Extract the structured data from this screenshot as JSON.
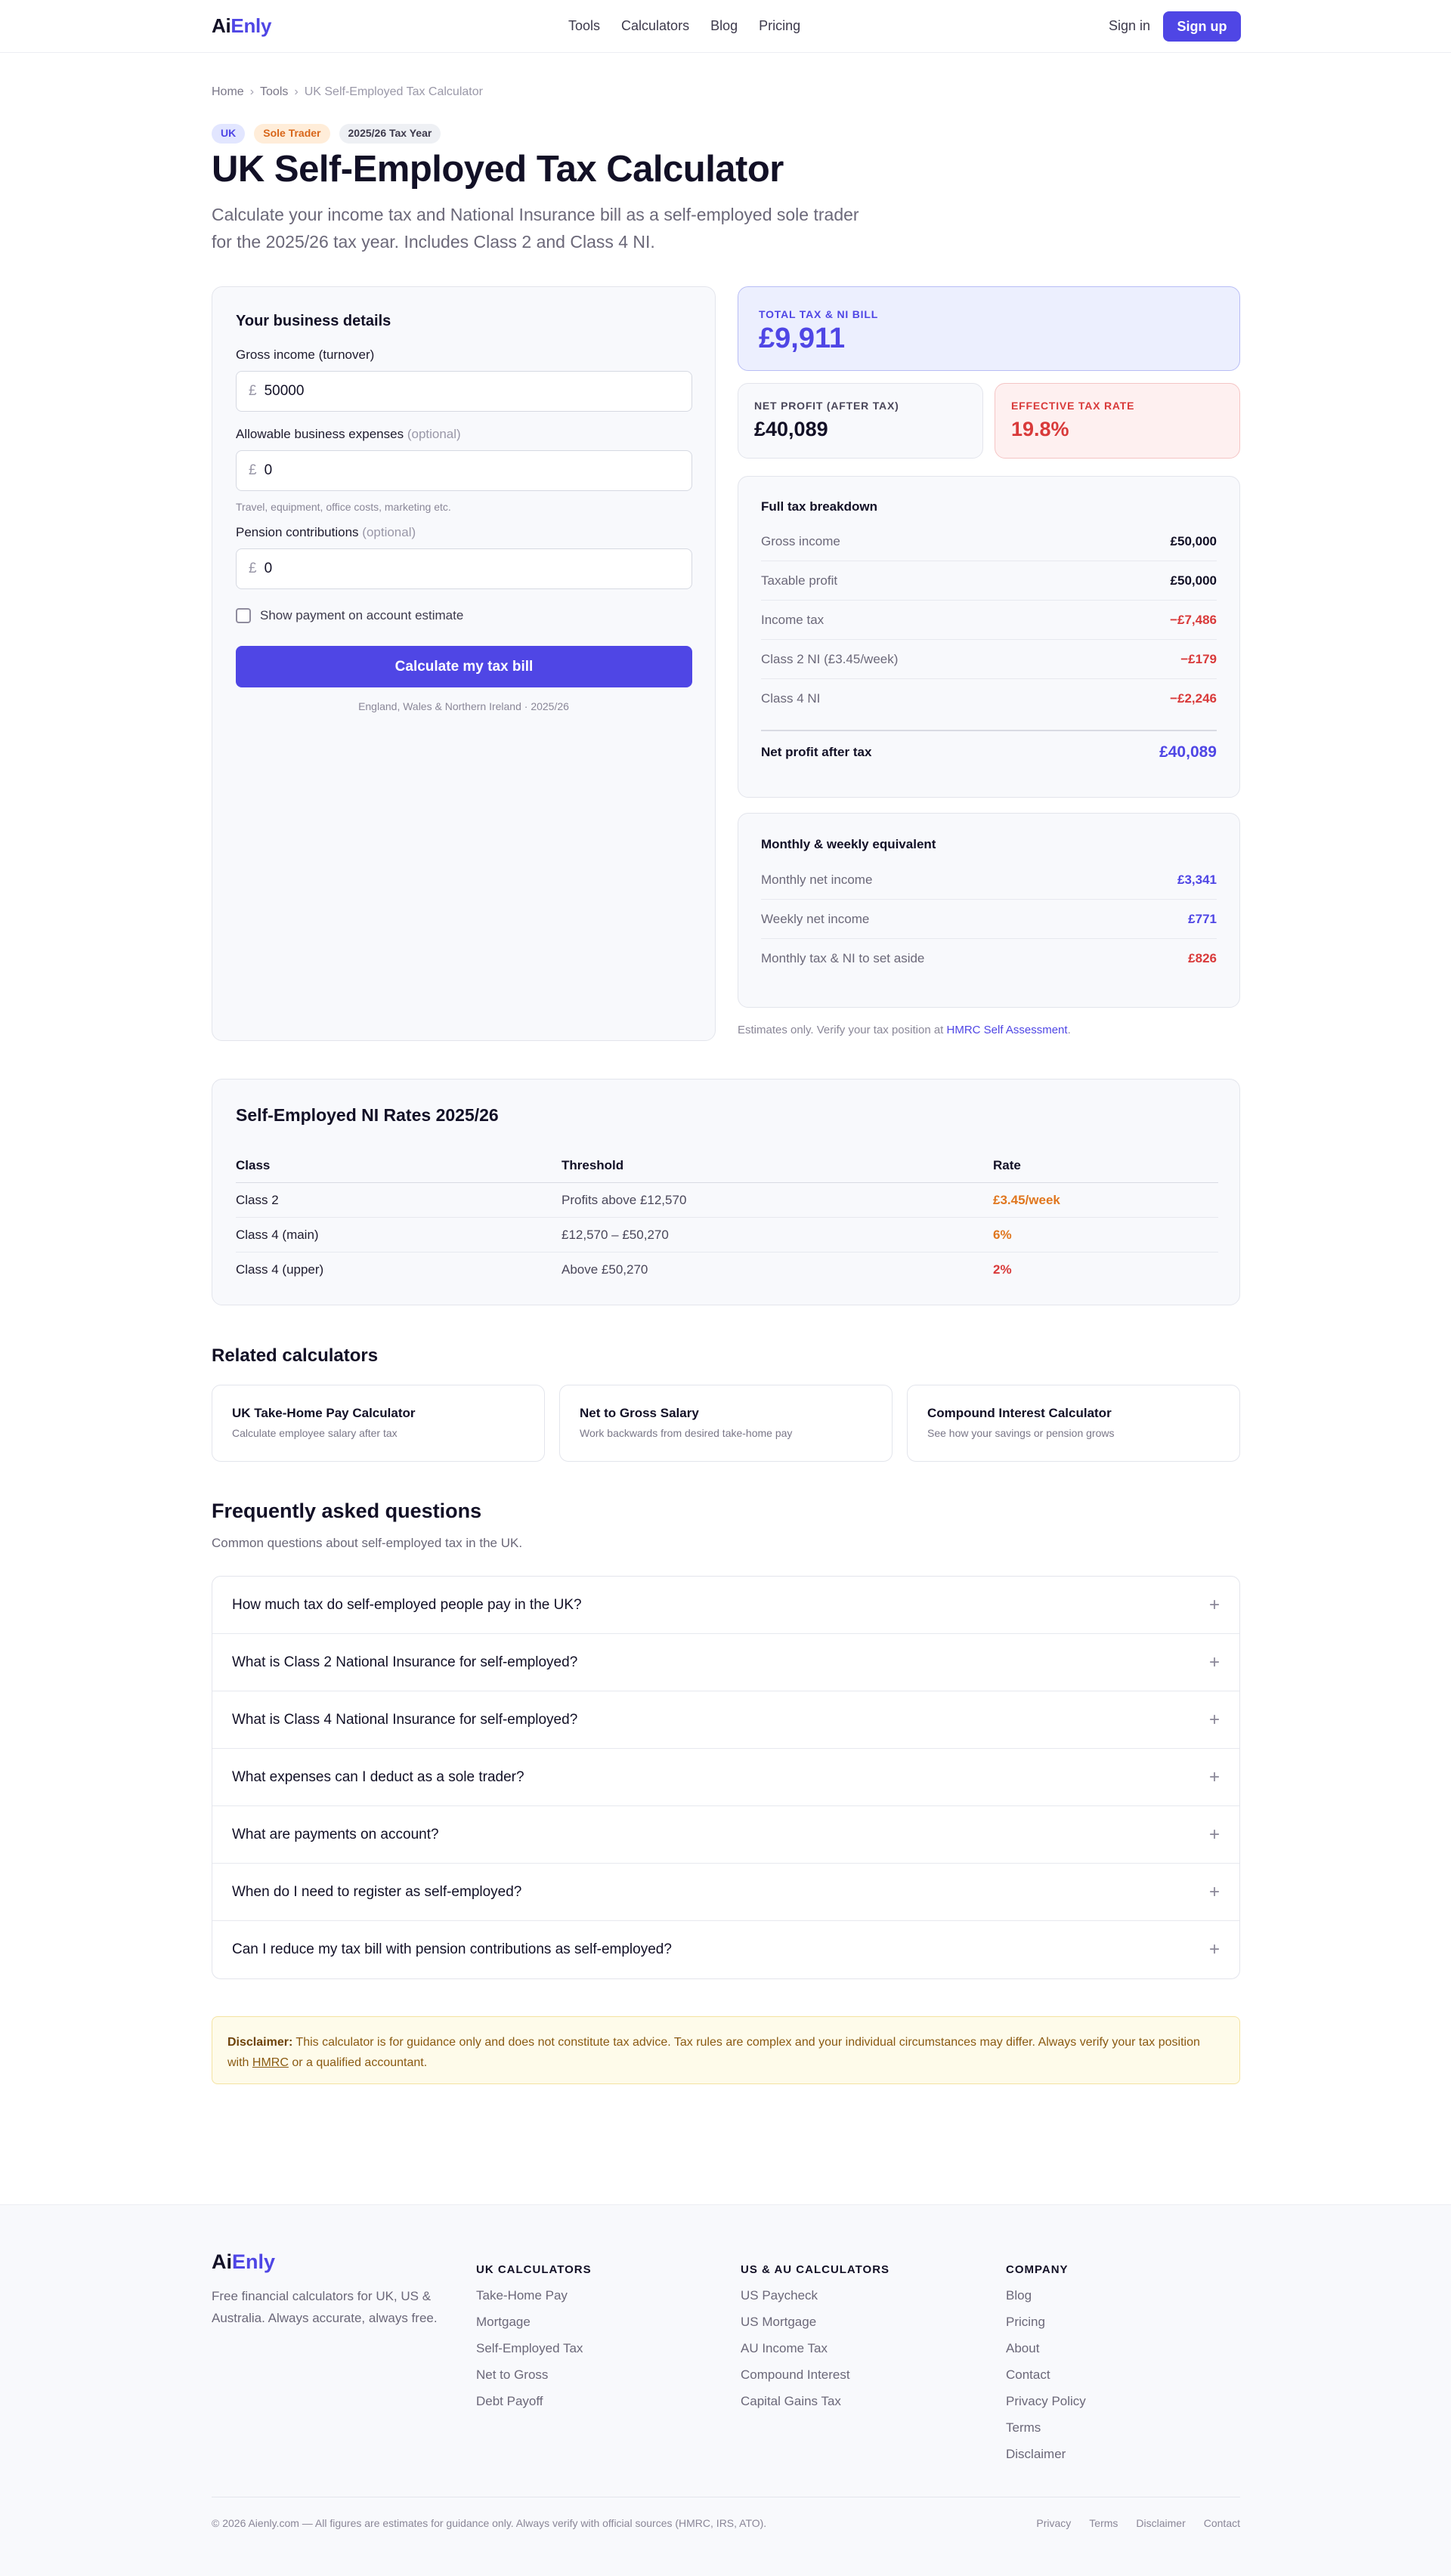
{
  "header": {
    "logo_ai": "Ai",
    "logo_enly": "Enly",
    "nav": [
      "Tools",
      "Calculators",
      "Blog",
      "Pricing"
    ],
    "sign_in": "Sign in",
    "sign_up": "Sign up"
  },
  "breadcrumb": [
    "Home",
    "Tools",
    "UK Self-Employed Tax Calculator"
  ],
  "tags": [
    "UK",
    "Sole Trader",
    "2025/26 Tax Year"
  ],
  "hero": {
    "title": "UK Self-Employed Tax Calculator",
    "subtitle": "Calculate your income tax and National Insurance bill as a self-employed sole trader for the 2025/26 tax year. Includes Class 2 and Class 4 NI."
  },
  "form": {
    "title": "Your business details",
    "currency": "£",
    "gross_label": "Gross income (turnover)",
    "gross_value": "50000",
    "expenses_label": "Allowable business expenses",
    "optional": "(optional)",
    "expenses_value": "0",
    "expenses_help": "Travel, equipment, office costs, marketing etc.",
    "pension_label": "Pension contributions",
    "pension_value": "0",
    "checkbox_label": "Show payment on account estimate",
    "button": "Calculate my tax bill",
    "note": "England, Wales & Northern Ireland · 2025/26"
  },
  "results": {
    "total_label": "TOTAL TAX & NI BILL",
    "total_value": "£9,911",
    "net_label": "NET PROFIT (AFTER TAX)",
    "net_value": "£40,089",
    "eff_label": "EFFECTIVE TAX RATE",
    "eff_value": "19.8%"
  },
  "breakdown": {
    "title": "Full tax breakdown",
    "rows": [
      {
        "label": "Gross income",
        "value": "£50,000"
      },
      {
        "label": "Taxable profit",
        "value": "£50,000"
      },
      {
        "label": "Income tax",
        "value": "−£7,486"
      },
      {
        "label": "Class 2 NI (£3.45/week)",
        "value": "−£179"
      },
      {
        "label": "Class 4 NI",
        "value": "−£2,246"
      }
    ],
    "total_label": "Net profit after tax",
    "total_value": "£40,089"
  },
  "monthly": {
    "title": "Monthly & weekly equivalent",
    "rows": [
      {
        "label": "Monthly net income",
        "value": "£3,341"
      },
      {
        "label": "Weekly net income",
        "value": "£771"
      },
      {
        "label": "Monthly tax & NI to set aside",
        "value": "£826"
      }
    ]
  },
  "estimate": {
    "text": "Estimates only. Verify your tax position at ",
    "link": "HMRC Self Assessment",
    "end": "."
  },
  "ni_table": {
    "title": "Self-Employed NI Rates 2025/26",
    "headers": [
      "Class",
      "Threshold",
      "Rate"
    ],
    "rows": [
      {
        "class": "Class 2",
        "threshold": "Profits above £12,570",
        "rate": "£3.45/week"
      },
      {
        "class": "Class 4 (main)",
        "threshold": "£12,570 – £50,270",
        "rate": "6%"
      },
      {
        "class": "Class 4 (upper)",
        "threshold": "Above £50,270",
        "rate": "2%"
      }
    ]
  },
  "related": {
    "title": "Related calculators",
    "items": [
      {
        "name": "UK Take-Home Pay Calculator",
        "desc": "Calculate employee salary after tax"
      },
      {
        "name": "Net to Gross Salary",
        "desc": "Work backwards from desired take-home pay"
      },
      {
        "name": "Compound Interest Calculator",
        "desc": "See how your savings or pension grows"
      }
    ]
  },
  "faq": {
    "title": "Frequently asked questions",
    "subtitle": "Common questions about self-employed tax in the UK.",
    "items": [
      "How much tax do self-employed people pay in the UK?",
      "What is Class 2 National Insurance for self-employed?",
      "What is Class 4 National Insurance for self-employed?",
      "What expenses can I deduct as a sole trader?",
      "What are payments on account?",
      "When do I need to register as self-employed?",
      "Can I reduce my tax bill with pension contributions as self-employed?"
    ],
    "expand_symbol": "+"
  },
  "disclaimer": {
    "bold": "Disclaimer:",
    "text": " This calculator is for guidance only and does not constitute tax advice. Tax rules are complex and your individual circumstances may differ. Always verify your tax position with ",
    "link": "HMRC",
    "end": " or a qualified accountant."
  },
  "footer": {
    "logo_ai": "Ai",
    "logo_enly": "Enly",
    "about": "Free financial calculators for UK, US & Australia. Always accurate, always free.",
    "columns": [
      {
        "title": "UK CALCULATORS",
        "links": [
          "Take-Home Pay",
          "Mortgage",
          "Self-Employed Tax",
          "Net to Gross",
          "Debt Payoff"
        ]
      },
      {
        "title": "US & AU CALCULATORS",
        "links": [
          "US Paycheck",
          "US Mortgage",
          "AU Income Tax",
          "Compound Interest",
          "Capital Gains Tax"
        ]
      },
      {
        "title": "COMPANY",
        "links": [
          "Blog",
          "Pricing",
          "About",
          "Contact",
          "Privacy Policy",
          "Terms",
          "Disclaimer"
        ]
      }
    ],
    "copyright": "© 2026 Aienly.com — All figures are estimates for guidance only. Always verify with official sources (HMRC, IRS, ATO).",
    "bottom_links": [
      "Privacy",
      "Terms",
      "Disclaimer",
      "Contact"
    ]
  },
  "colors": {
    "accent": "#4f46e5",
    "negative": "#d93a3a",
    "orange": "#e0771f"
  }
}
